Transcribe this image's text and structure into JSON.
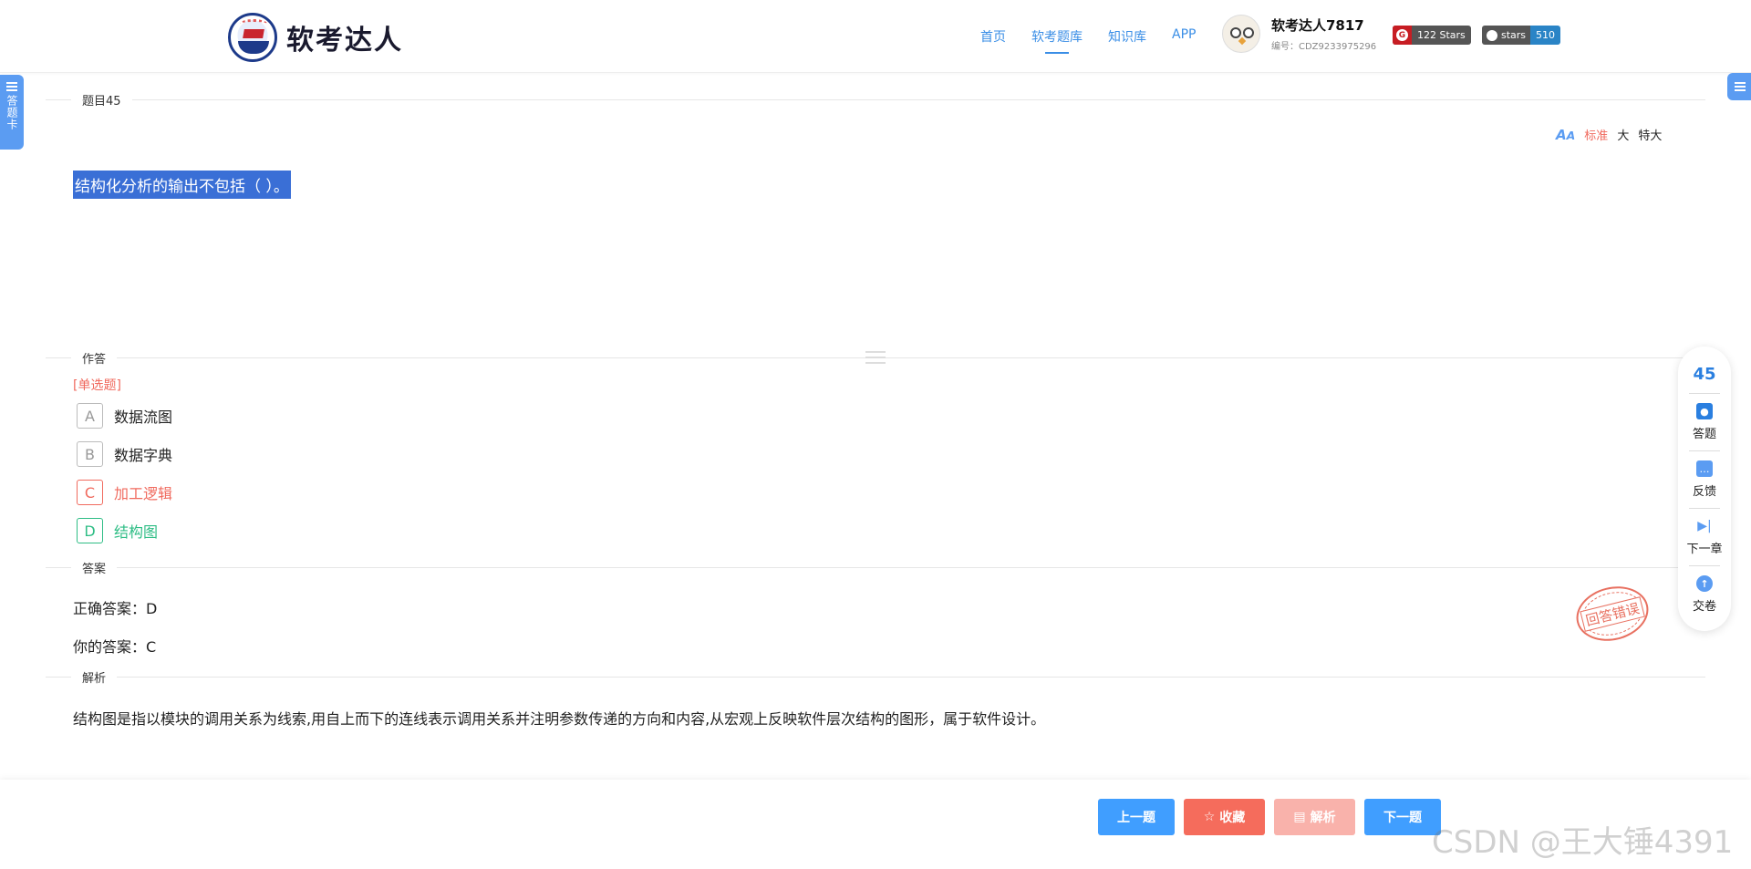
{
  "header": {
    "logo_text": "软考达人",
    "nav": [
      "首页",
      "软考题库",
      "知识库",
      "APP"
    ],
    "active_nav": "软考题库",
    "user": {
      "name": "软考达人7817",
      "id": "编号：CDZ9233975296"
    },
    "badges": {
      "gitee": {
        "icon": "G",
        "label": "122 Stars"
      },
      "github": {
        "label": "stars",
        "count": "510"
      }
    }
  },
  "left_tab": {
    "label": "答题卡"
  },
  "question": {
    "section_title": "题目45",
    "font_sizes": [
      "标准",
      "大",
      "特大"
    ],
    "font_size_selected": "标准",
    "text": "结构化分析的输出不包括（ ）。"
  },
  "answer_section": {
    "title": "作答",
    "type": "[单选题]",
    "options": [
      {
        "letter": "A",
        "text": "数据流图",
        "state": "normal"
      },
      {
        "letter": "B",
        "text": "数据字典",
        "state": "normal"
      },
      {
        "letter": "C",
        "text": "加工逻辑",
        "state": "wrong"
      },
      {
        "letter": "D",
        "text": "结构图",
        "state": "correct"
      }
    ]
  },
  "result_section": {
    "title": "答案",
    "correct_answer": "正确答案：D",
    "your_answer": "你的答案：C",
    "stamp": "回答错误"
  },
  "analysis_section": {
    "title": "解析",
    "text": "结构图是指以模块的调用关系为线索,用自上而下的连线表示调用关系并注明参数传递的方向和内容,从宏观上反映软件层次结构的图形，属于软件设计。"
  },
  "side_panel": {
    "number": "45",
    "items": [
      "答题",
      "反馈",
      "下一章",
      "交卷"
    ]
  },
  "bottom_bar": {
    "prev": "上一题",
    "favorite": "收藏",
    "analysis": "解析",
    "next": "下一题"
  },
  "watermark": "CSDN @王大锤4391",
  "colors": {
    "accent": "#409eff",
    "wrong": "#f06a5e",
    "correct": "#2ebd85",
    "highlight": "#3a6fd6"
  }
}
